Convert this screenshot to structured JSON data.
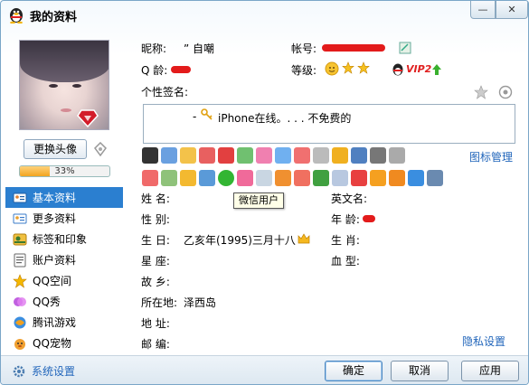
{
  "window": {
    "title": "我的资料",
    "min_glyph": "—",
    "close_glyph": "✕"
  },
  "left": {
    "change_avatar_label": "更换头像",
    "completion_percent": 33,
    "completion_text": "33%",
    "nav": [
      {
        "label": "基本资料",
        "icon": "id-card-icon",
        "active": true
      },
      {
        "label": "更多资料",
        "icon": "more-info-icon",
        "active": false
      },
      {
        "label": "标签和印象",
        "icon": "tag-icon",
        "active": false
      },
      {
        "label": "账户资料",
        "icon": "account-icon",
        "active": false
      },
      {
        "label": "QQ空间",
        "icon": "qzone-star-icon",
        "active": false
      },
      {
        "label": "QQ秀",
        "icon": "qq-show-icon",
        "active": false
      },
      {
        "label": "腾讯游戏",
        "icon": "games-icon",
        "active": false
      },
      {
        "label": "QQ宠物",
        "icon": "pet-icon",
        "active": false
      }
    ]
  },
  "profile": {
    "nickname_label": "昵称:",
    "nickname_value": "” 自嘲",
    "account_label": "帐号:",
    "qq_age_label": "Q 龄:",
    "level_label": "等级:",
    "vip_text": "VIP2",
    "signature_label": "个性签名:",
    "signature_text": "- 🔑 iPhone在线。. . . 不免费的",
    "signature_prefix": "-",
    "signature_body": "iPhone在线。. . . 不免费的",
    "icon_manage_label": "图标管理",
    "tooltip": "微信用户",
    "fields_left": [
      {
        "label": "姓    名:",
        "value": ""
      },
      {
        "label": "性    别:",
        "value": ""
      },
      {
        "label": "生    日:",
        "value": "乙亥年(1995)三月十八"
      },
      {
        "label": "星    座:",
        "value": ""
      },
      {
        "label": "故    乡:",
        "value": ""
      },
      {
        "label": "所在地:",
        "value": "泽西岛"
      },
      {
        "label": "地    址:",
        "value": ""
      },
      {
        "label": "邮    编:",
        "value": ""
      }
    ],
    "fields_right": [
      {
        "label": "英文名:",
        "value": ""
      },
      {
        "label": "年    龄:",
        "value": ""
      },
      {
        "label": "生    肖:",
        "value": ""
      },
      {
        "label": "血    型:",
        "value": ""
      }
    ],
    "privacy_label": "隐私设置"
  },
  "footer": {
    "system_settings_label": "系统设置",
    "ok_label": "确定",
    "cancel_label": "取消",
    "apply_label": "应用"
  },
  "colors": {
    "accent": "#2b7fd0",
    "link": "#2266bb",
    "redaction": "#e31b1b",
    "progress": "#f2a420"
  }
}
